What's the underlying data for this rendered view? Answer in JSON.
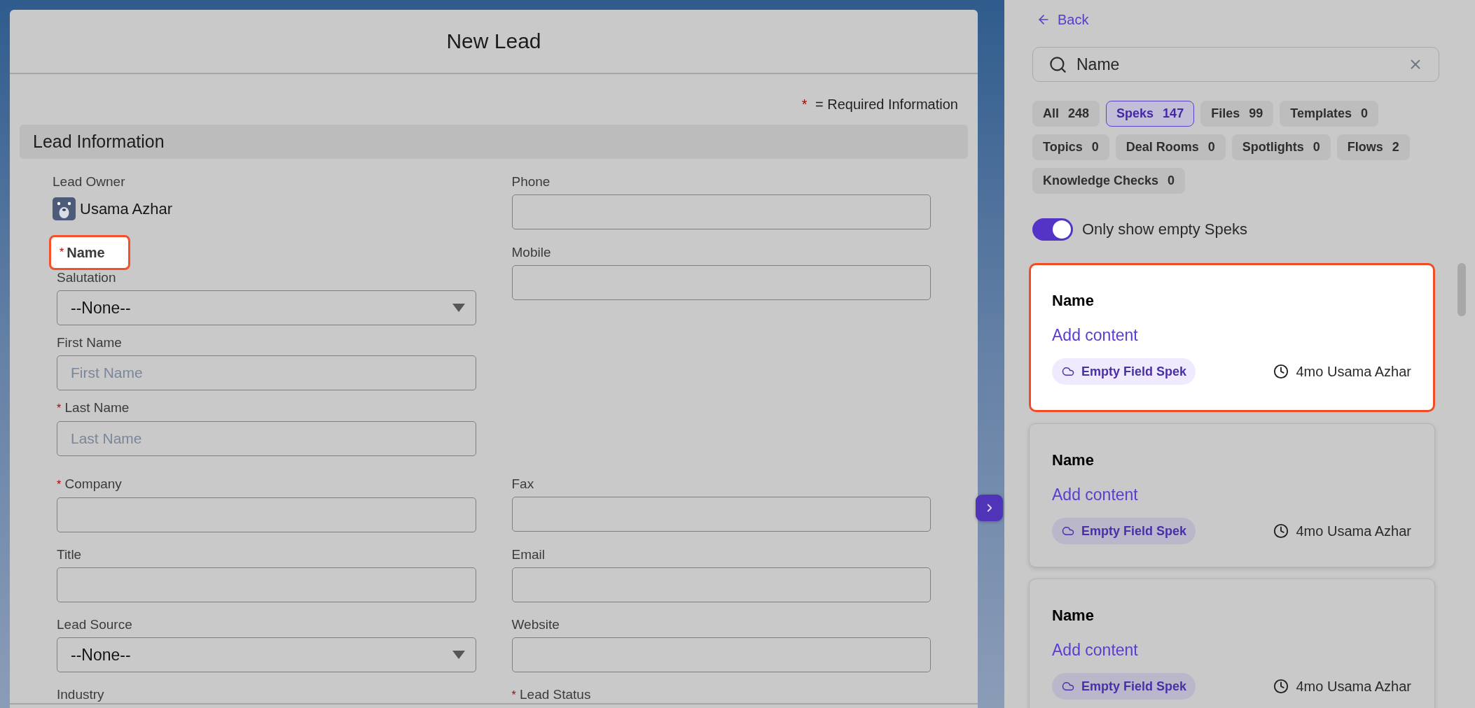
{
  "modal": {
    "title": "New Lead",
    "required_note": {
      "marker": "*",
      "text": "= Required Information"
    },
    "section": "Lead Information",
    "top_left": [
      {
        "kind": "owner",
        "label": "Lead Owner",
        "value": "Usama Azhar"
      },
      {
        "kind": "heading",
        "marker": "*",
        "label": "Name",
        "highlighted": true
      },
      {
        "kind": "select",
        "label": "Salutation",
        "value": "--None--"
      },
      {
        "kind": "text",
        "label": "First Name",
        "placeholder": "First Name"
      },
      {
        "kind": "text",
        "marker": "*",
        "label": "Last Name",
        "placeholder": "Last Name"
      }
    ],
    "top_right": [
      {
        "kind": "text",
        "label": "Phone"
      },
      {
        "kind": "text",
        "label": "Mobile"
      }
    ],
    "rows": [
      [
        {
          "kind": "text",
          "marker": "*",
          "label": "Company"
        },
        {
          "kind": "text",
          "label": "Fax"
        }
      ],
      [
        {
          "kind": "text",
          "label": "Title"
        },
        {
          "kind": "text",
          "label": "Email"
        }
      ],
      [
        {
          "kind": "select",
          "label": "Lead Source",
          "value": "--None--"
        },
        {
          "kind": "text",
          "label": "Website"
        }
      ],
      [
        {
          "kind": "label",
          "label": "Industry"
        },
        {
          "kind": "label",
          "marker": "*",
          "label": "Lead Status"
        }
      ]
    ]
  },
  "panel": {
    "back": "Back",
    "search": {
      "value": "Name"
    },
    "filters": [
      {
        "label": "All",
        "count": "248",
        "selected": false
      },
      {
        "label": "Speks",
        "count": "147",
        "selected": true
      },
      {
        "label": "Files",
        "count": "99",
        "selected": false
      },
      {
        "label": "Templates",
        "count": "0",
        "selected": false
      },
      {
        "label": "Topics",
        "count": "0",
        "selected": false
      },
      {
        "label": "Deal Rooms",
        "count": "0",
        "selected": false
      },
      {
        "label": "Spotlights",
        "count": "0",
        "selected": false
      },
      {
        "label": "Flows",
        "count": "2",
        "selected": false
      },
      {
        "label": "Knowledge Checks",
        "count": "0",
        "selected": false
      }
    ],
    "toggle": {
      "label": "Only show empty Speks",
      "on": true
    },
    "cards": [
      {
        "title": "Name",
        "action": "Add content",
        "tag": "Empty Field Spek",
        "meta": "4mo Usama Azhar",
        "highlighted": true
      },
      {
        "title": "Name",
        "action": "Add content",
        "tag": "Empty Field Spek",
        "meta": "4mo Usama Azhar",
        "highlighted": false
      },
      {
        "title": "Name",
        "action": "Add content",
        "tag": "Empty Field Spek",
        "meta": "4mo Usama Azhar",
        "highlighted": false
      }
    ]
  }
}
